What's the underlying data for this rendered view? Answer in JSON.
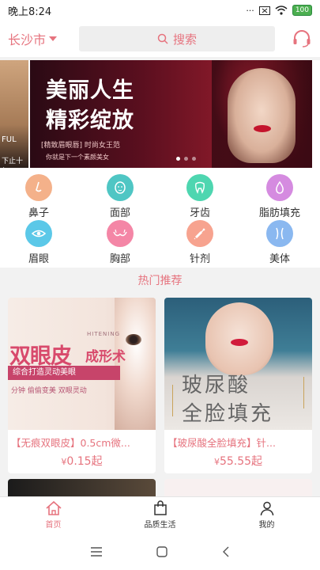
{
  "status_bar": {
    "time": "晚上8:24",
    "battery": "100"
  },
  "header": {
    "city": "长沙市",
    "search_placeholder": "搜索"
  },
  "banner": {
    "left_lines": [
      "",
      "FUL",
      "下止十年"
    ],
    "title_line1": "美丽人生",
    "title_line2": "精彩绽放",
    "subtitle": "[精致眉眼唇] 时尚女王范",
    "subtitle2": "你就是下一个素颜美女",
    "dots": 3,
    "active_dot": 1
  },
  "categories": [
    {
      "label": "鼻子",
      "color": "#f4b18a",
      "icon": "nose-icon"
    },
    {
      "label": "面部",
      "color": "#4fc6c4",
      "icon": "face-icon"
    },
    {
      "label": "牙齿",
      "color": "#4ed6b0",
      "icon": "tooth-icon"
    },
    {
      "label": "脂肪填充",
      "color": "#d58be0",
      "icon": "drop-icon"
    },
    {
      "label": "眉眼",
      "color": "#5bc8e8",
      "icon": "eye-icon"
    },
    {
      "label": "胸部",
      "color": "#f486a6",
      "icon": "bra-icon"
    },
    {
      "label": "针剂",
      "color": "#f7a38f",
      "icon": "syringe-icon"
    },
    {
      "label": "美体",
      "color": "#8ab8f0",
      "icon": "body-icon"
    }
  ],
  "section_title": "热门推荐",
  "products": [
    {
      "title": "【无痕双眼皮】0.5cm微...",
      "price": "0.15起",
      "image_text": {
        "big": "双眼皮",
        "big2": "成形术",
        "en": "HITENING",
        "band": "综合打造灵动美眼",
        "line3": "分钟 偷偷变美 双眼灵动"
      }
    },
    {
      "title": "【玻尿酸全脸填充】针...",
      "price": "55.55起",
      "image_text": {
        "t1": "玻尿酸",
        "t2": "全脸填充"
      }
    }
  ],
  "tabs": [
    {
      "label": "首页",
      "icon": "home-icon",
      "active": true
    },
    {
      "label": "品质生活",
      "icon": "shopping-bag-icon",
      "active": false
    },
    {
      "label": "我的",
      "icon": "user-icon",
      "active": false
    }
  ],
  "colors": {
    "accent": "#e6737e"
  }
}
